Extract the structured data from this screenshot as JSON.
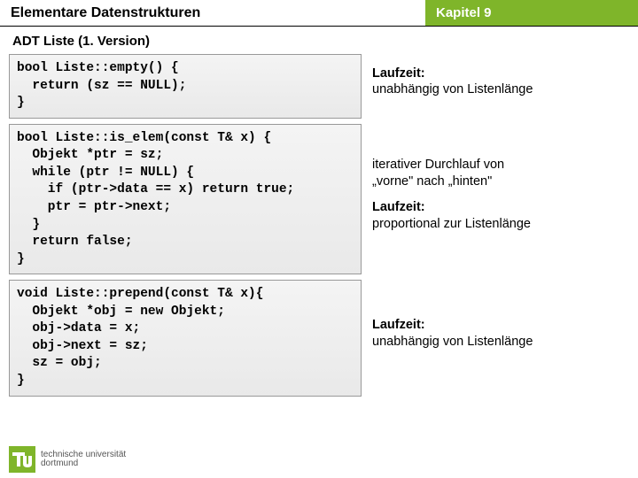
{
  "header": {
    "left": "Elementare Datenstrukturen",
    "right": "Kapitel 9"
  },
  "subtitle": "ADT Liste (1. Version)",
  "rows": [
    {
      "code": "bool Liste::empty() {\n  return (sz == NULL);\n}",
      "annot_strong1": "Laufzeit:",
      "annot_text1": "unabhängig von Listenlänge"
    },
    {
      "code": "bool Liste::is_elem(const T& x) {\n  Objekt *ptr = sz;\n  while (ptr != NULL) {\n    if (ptr->data == x) return true;\n    ptr = ptr->next;\n  }\n  return false;\n}",
      "annot_pre1": "iterativer Durchlauf von",
      "annot_pre2": "„vorne\" nach „hinten\"",
      "annot_strong1": "Laufzeit:",
      "annot_text1": "proportional zur Listenlänge"
    },
    {
      "code": "void Liste::prepend(const T& x){\n  Objekt *obj = new Objekt;\n  obj->data = x;\n  obj->next = sz;\n  sz = obj;\n}",
      "annot_strong1": "Laufzeit:",
      "annot_text1": "unabhängig von Listenlänge"
    }
  ],
  "footer": {
    "line1": "technische universität",
    "line2": "dortmund"
  }
}
